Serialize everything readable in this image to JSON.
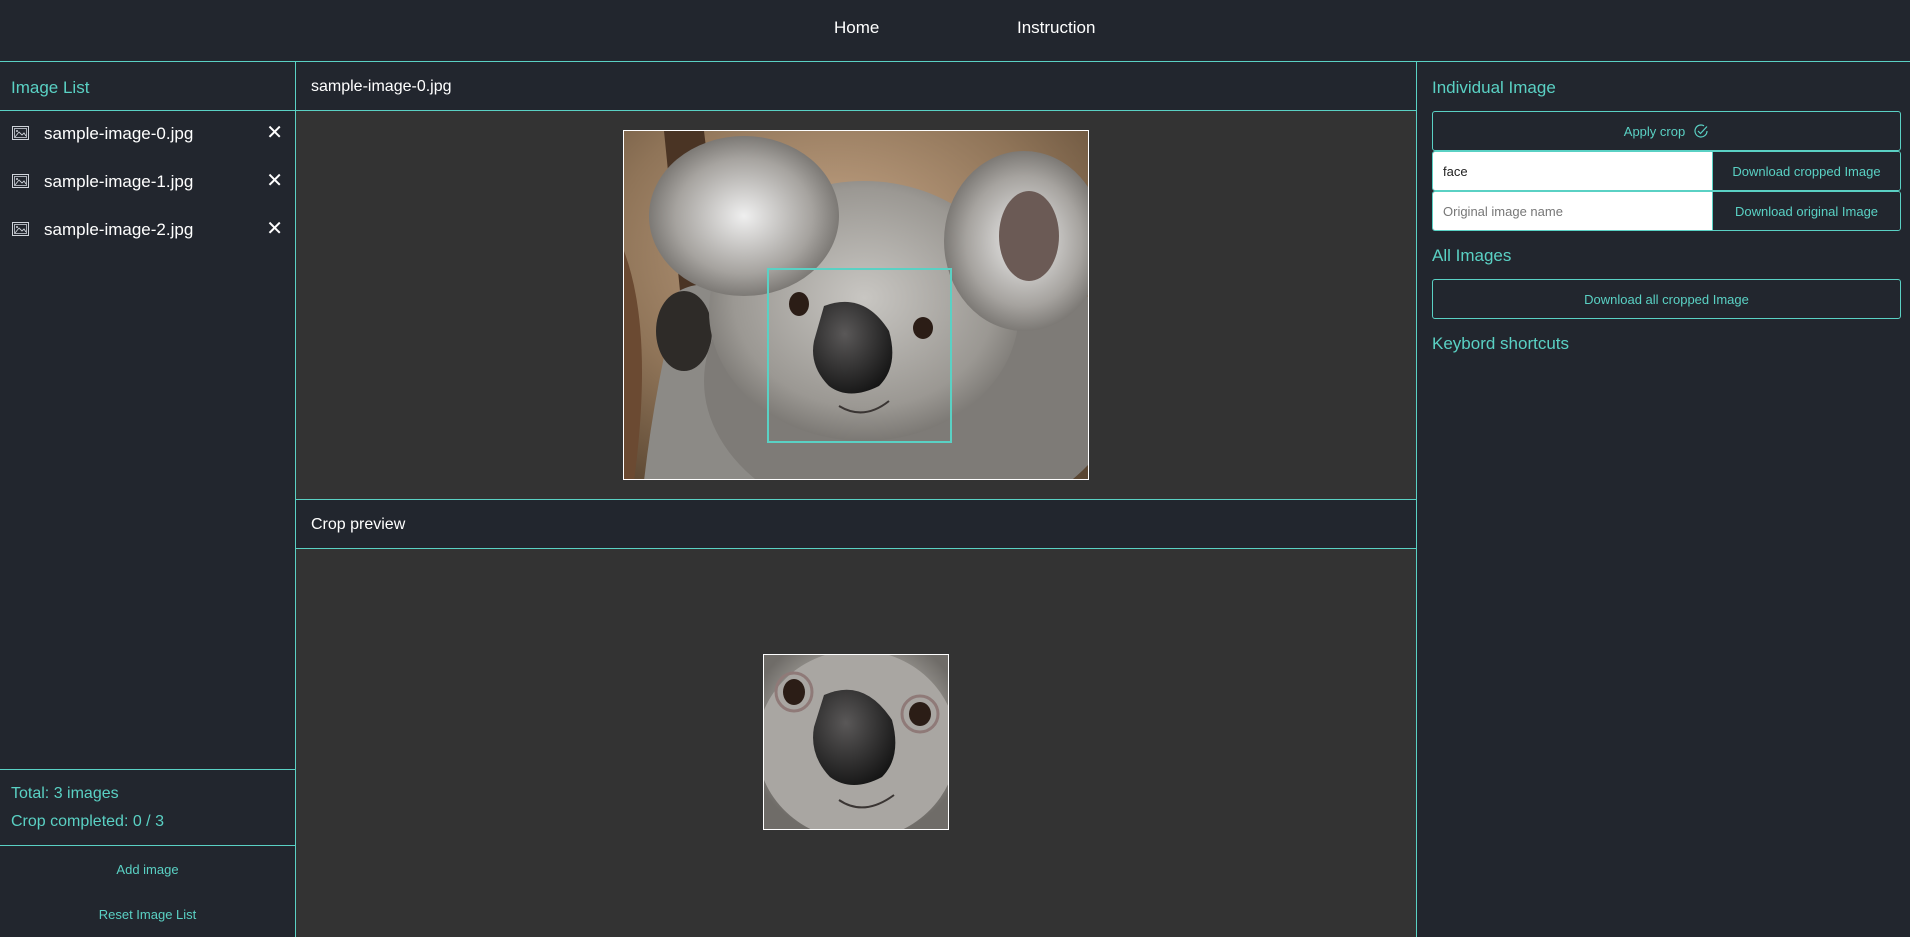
{
  "nav": {
    "home": "Home",
    "instruction": "Instruction"
  },
  "sidebar": {
    "title": "Image List",
    "items": [
      {
        "label": "sample-image-0.jpg",
        "icon": "image-file-icon",
        "remove_icon": "close-icon",
        "remove": "✕"
      },
      {
        "label": "sample-image-1.jpg",
        "icon": "image-file-icon",
        "remove_icon": "close-icon",
        "remove": "✕"
      },
      {
        "label": "sample-image-2.jpg",
        "icon": "image-file-icon",
        "remove_icon": "close-icon",
        "remove": "✕"
      }
    ],
    "total": "Total: 3 images",
    "crop_completed": "Crop completed: 0 / 3",
    "add_image": "Add image",
    "reset": "Reset Image List"
  },
  "center": {
    "image_title": "sample-image-0.jpg",
    "preview_title": "Crop preview"
  },
  "right": {
    "individual_title": "Individual Image",
    "apply_crop": "Apply crop",
    "apply_icon": "check-circle-icon",
    "crop_name_value": "face",
    "download_cropped": "Download cropped Image",
    "original_placeholder": "Original image name",
    "download_original": "Download original Image",
    "all_title": "All Images",
    "download_all": "Download all cropped Image",
    "shortcuts_title": "Keybord shortcuts"
  },
  "colors": {
    "accent": "#5ad1c4",
    "background": "#22262e",
    "canvas": "#333333"
  }
}
